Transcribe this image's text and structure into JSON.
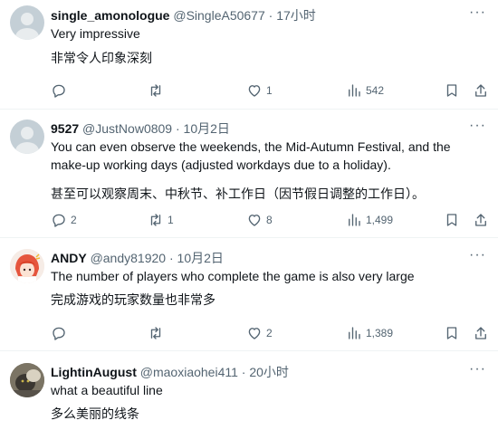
{
  "replies": [
    {
      "name": "single_amonologue",
      "handle": "@SingleA50677",
      "time": "17小时",
      "text": "Very impressive",
      "translation": "非常令人印象深刻",
      "counts": {
        "reply": "",
        "retweet": "",
        "like": "1",
        "views": "542"
      },
      "avatar": "default-avatar"
    },
    {
      "name": "9527",
      "handle": "@JustNow0809",
      "time": "10月2日",
      "text": "You can even observe the weekends, the Mid-Autumn Festival, and the make-up working days (adjusted workdays due to a holiday).",
      "translation": "甚至可以观察周末、中秋节、补工作日（因节假日调整的工作日）。",
      "counts": {
        "reply": "2",
        "retweet": "1",
        "like": "8",
        "views": "1,499"
      },
      "avatar": "default-avatar"
    },
    {
      "name": "ANDY",
      "handle": "@andy81920",
      "time": "10月2日",
      "text": "The number of players who complete the game is also very large",
      "translation": "完成游戏的玩家数量也非常多",
      "counts": {
        "reply": "",
        "retweet": "",
        "like": "2",
        "views": "1,389"
      },
      "avatar": "anime-avatar"
    },
    {
      "name": "LightinAugust",
      "handle": "@maoxiaohei411",
      "time": "20小时",
      "text": "what a beautiful line",
      "translation": "多么美丽的线条",
      "counts": {
        "reply": "",
        "retweet": "",
        "like": "",
        "views": ""
      },
      "avatar": "photo-avatar"
    }
  ],
  "dot": "·",
  "more_glyph": "···",
  "icons": [
    "more-icon",
    "reply-icon",
    "retweet-icon",
    "like-icon",
    "views-icon",
    "bookmark-icon",
    "share-icon"
  ],
  "colors": {
    "text": "#0f1419",
    "muted": "#536471",
    "divider": "#eff3f4",
    "avatar_default": "#c4cfd6"
  }
}
